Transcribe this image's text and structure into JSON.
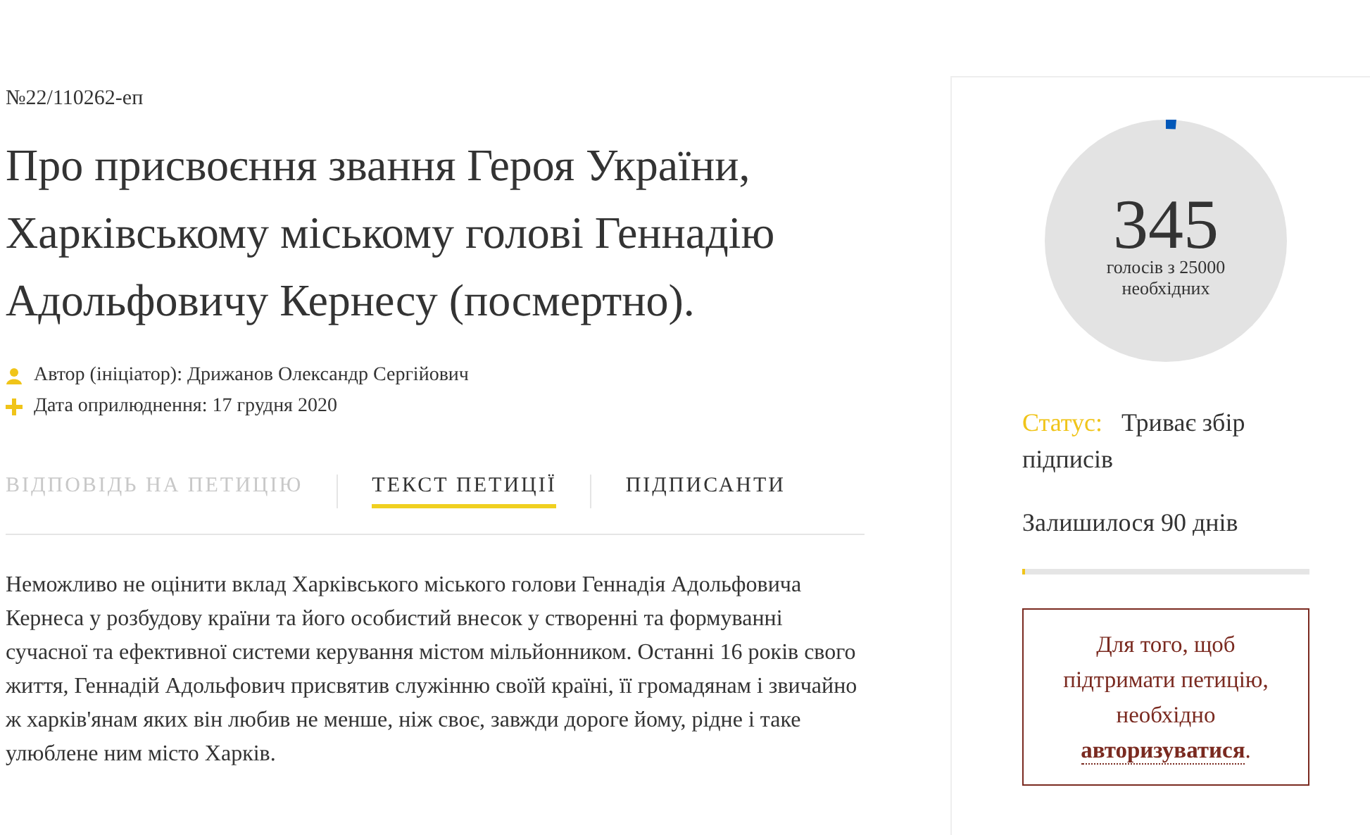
{
  "petition": {
    "number": "№22/110262-еп",
    "title": "Про присвоєння звання Героя України, Харківському міському голові Геннадію Адольфовичу Кернесу (посмертно).",
    "meta": [
      {
        "kind": "author",
        "text": "Автор (ініціатор): Дрижанов Олександр Сергійович"
      },
      {
        "kind": "date",
        "text": "Дата оприлюднення: 17 грудня 2020"
      }
    ]
  },
  "tabs": [
    {
      "label": "ВІДПОВІДЬ НА ПЕТИЦІЮ",
      "selected": false,
      "disabled": true
    },
    {
      "label": "ТЕКСТ ПЕТИЦІЇ",
      "selected": true,
      "disabled": false
    },
    {
      "label": "ПІДПИСАНТИ",
      "selected": false,
      "disabled": false
    }
  ],
  "body": "Неможливо не оцінити вклад Харківського міського голови Геннадія Адольфовича Кернеса у розбудову країни та його особистий внесок у створенні та формуванні сучасної та ефективної системи керування містом мільйонником. Останні 16 років свого життя, Геннадій Адольфович присвятив служінню своїй країні, її громадянам і звичайно ж харків'янам яких він любив не менше, ніж своє, завжди дороге йому, рідне і таке улюблене ним місто Харків.",
  "sidebar": {
    "votes": {
      "count": "345",
      "caption": "голосів з 25000 необхідних",
      "level": 0.0138
    },
    "status": {
      "label": "Статус:",
      "value": "Триває збір підписів"
    },
    "remaining": {
      "text": "Залишилося 90 днів",
      "level": 0.01
    },
    "notice": {
      "before": "Для того, щоб підтримати петицію, необхідно",
      "link": "авторизуватися",
      "after": "."
    }
  }
}
